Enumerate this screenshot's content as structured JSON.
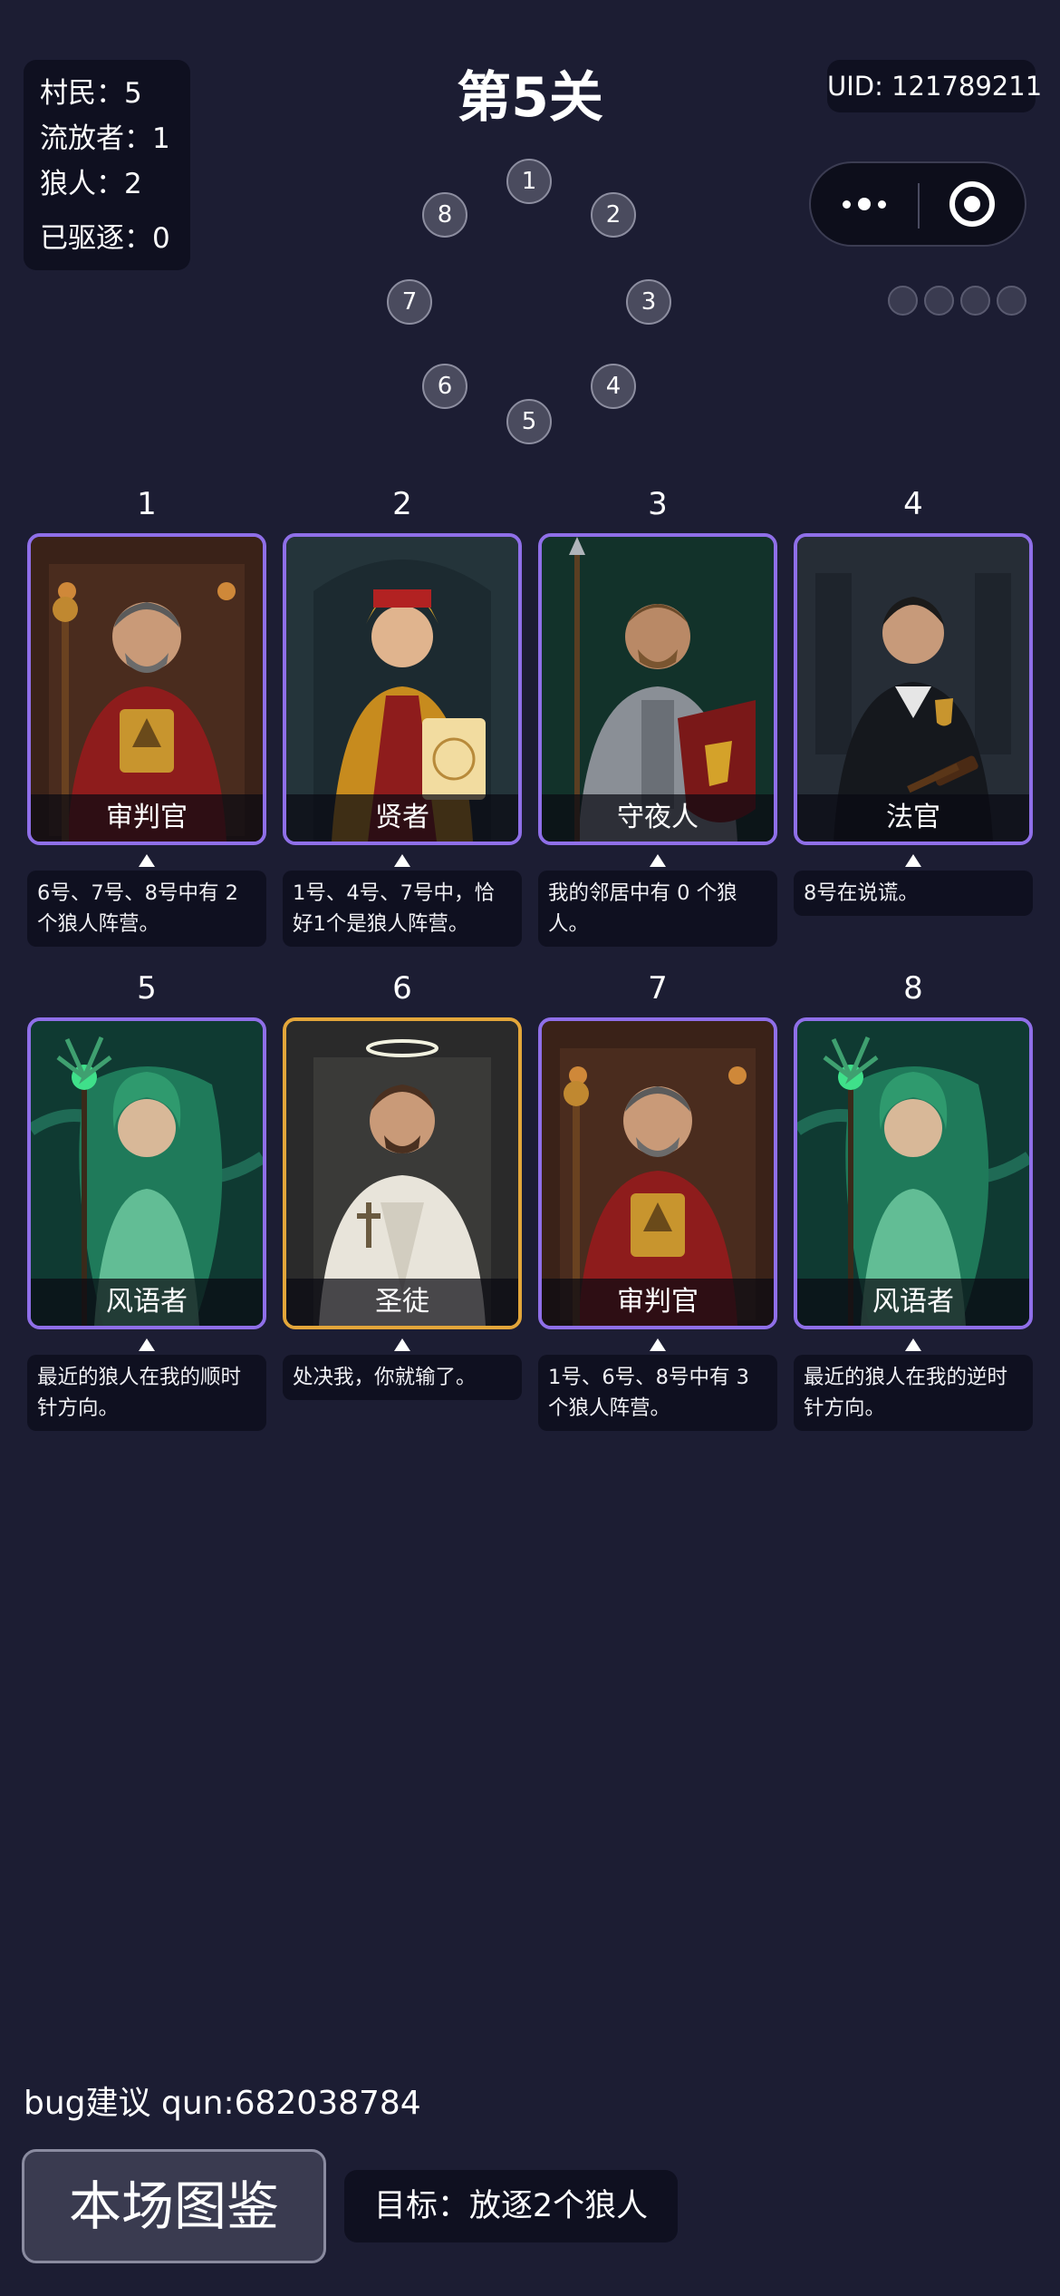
{
  "stats": [
    {
      "label": "村民",
      "sep": "：",
      "value": "5"
    },
    {
      "label": "流放者",
      "sep": "：",
      "value": "1"
    },
    {
      "label": "狼人",
      "sep": "：",
      "value": "2"
    },
    {
      "label": "已驱逐",
      "sep": "：",
      "value": "0"
    }
  ],
  "level_title": "第5关",
  "uid": "UID: 121789211",
  "capsule": {
    "more_icon": "more-dots-icon",
    "close_icon": "target-close-icon"
  },
  "seats": [
    "1",
    "2",
    "3",
    "4",
    "5",
    "6",
    "7",
    "8"
  ],
  "cards": [
    {
      "num": "1",
      "role": "审判官",
      "clue": "6号、7号、8号中有 2 个狼人阵营。",
      "art": "judge"
    },
    {
      "num": "2",
      "role": "贤者",
      "clue": "1号、4号、7号中，恰好1个是狼人阵营。",
      "art": "sage"
    },
    {
      "num": "3",
      "role": "守夜人",
      "clue": "我的邻居中有 0 个狼人。",
      "art": "knight"
    },
    {
      "num": "4",
      "role": "法官",
      "clue": "8号在说谎。",
      "art": "magistrate"
    },
    {
      "num": "5",
      "role": "风语者",
      "clue": "最近的狼人在我的顺时针方向。",
      "art": "windspeaker"
    },
    {
      "num": "6",
      "role": "圣徒",
      "clue": "处决我，你就输了。",
      "art": "saint"
    },
    {
      "num": "7",
      "role": "审判官",
      "clue": "1号、6号、8号中有 3 个狼人阵营。",
      "art": "judge"
    },
    {
      "num": "8",
      "role": "风语者",
      "clue": "最近的狼人在我的逆时针方向。",
      "art": "windspeaker"
    }
  ],
  "bug_note": "bug建议 qun:682038784",
  "guide_button": "本场图鉴",
  "goal": "目标：放逐2个狼人",
  "colors": {
    "background": "#1c1d33",
    "panel": "#0f1020",
    "card_border": "#8f6fe8",
    "card_border_saint": "#e3a63a"
  }
}
